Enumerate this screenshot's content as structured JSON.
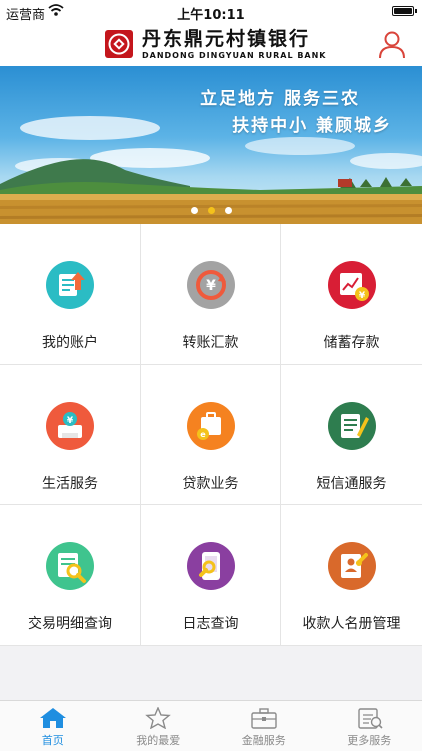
{
  "status_bar": {
    "carrier": "运营商",
    "time": "上午10:11",
    "battery_level": 1.0
  },
  "header": {
    "bank_name_cn": "丹东鼎元村镇银行",
    "bank_name_en": "DANDONG DINGYUAN RURAL BANK"
  },
  "banner": {
    "line1": "立足地方  服务三农",
    "line2": "扶持中小  兼顾城乡",
    "slide_count": 3,
    "active_slide": 1
  },
  "menu": {
    "items": [
      {
        "label": "我的账户",
        "icon": "account-icon",
        "color": "#2bbcc4"
      },
      {
        "label": "转账汇款",
        "icon": "transfer-icon",
        "color": "#a3a3a3"
      },
      {
        "label": "储蓄存款",
        "icon": "deposit-icon",
        "color": "#d81e35"
      },
      {
        "label": "生活服务",
        "icon": "life-service-icon",
        "color": "#ef5a3c"
      },
      {
        "label": "贷款业务",
        "icon": "loan-icon",
        "color": "#f58220"
      },
      {
        "label": "短信通服务",
        "icon": "sms-service-icon",
        "color": "#2e7d4f"
      },
      {
        "label": "交易明细查询",
        "icon": "transaction-query-icon",
        "color": "#3fc48e"
      },
      {
        "label": "日志查询",
        "icon": "log-query-icon",
        "color": "#8a3fa0"
      },
      {
        "label": "收款人名册管理",
        "icon": "payee-management-icon",
        "color": "#d9692b"
      }
    ]
  },
  "tab_bar": {
    "tabs": [
      {
        "label": "首页",
        "icon": "home-icon"
      },
      {
        "label": "我的最爱",
        "icon": "star-icon"
      },
      {
        "label": "金融服务",
        "icon": "briefcase-icon"
      },
      {
        "label": "更多服务",
        "icon": "more-services-icon"
      }
    ],
    "active": 0
  },
  "colors": {
    "brand_red": "#c4161c",
    "tab_active": "#1f8ee0",
    "tab_inactive": "#8a8a8a"
  }
}
